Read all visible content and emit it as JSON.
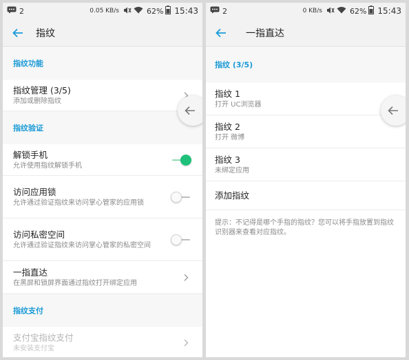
{
  "status_left": {
    "notification_count": "2",
    "net_speed": "0.05 KB/s",
    "battery": "62%",
    "time": "15:43"
  },
  "status_right": {
    "notification_count": "2",
    "net_speed": "0 KB/s",
    "battery": "62%",
    "time": "15:43"
  },
  "left": {
    "title": "指纹",
    "sections": {
      "function_header": "指纹功能",
      "verify_header": "指纹验证",
      "pay_header": "指纹支付"
    },
    "items": {
      "manage": {
        "title": "指纹管理 (3/5)",
        "sub": "添加或删除指纹"
      },
      "unlock": {
        "title": "解锁手机",
        "sub": "允许使用指纹解锁手机",
        "enabled": true
      },
      "app_lock": {
        "title": "访问应用锁",
        "sub": "允许通过验证指纹来访问掌心管家的应用锁",
        "enabled": false
      },
      "private_space": {
        "title": "访问私密空间",
        "sub": "允许通过验证指纹来访问掌心管家的私密空间",
        "enabled": false
      },
      "quick_launch": {
        "title": "一指直达",
        "sub": "在黑屏和锁屏界面通过指纹打开绑定应用"
      },
      "alipay": {
        "title": "支付宝指纹支付",
        "sub": "未安装支付宝"
      }
    }
  },
  "right": {
    "title": "一指直达",
    "section_header": "指纹 (3/5)",
    "fingerprints": [
      {
        "title": "指纹 1",
        "sub": "打开 UC浏览器"
      },
      {
        "title": "指纹 2",
        "sub": "打开 微博"
      },
      {
        "title": "指纹 3",
        "sub": "未绑定应用"
      }
    ],
    "add_label": "添加指纹",
    "hint": "提示：不记得是哪个手指的指纹？您可以将手指放置到指纹识别器来查看对应指纹。"
  },
  "colors": {
    "accent": "#1a9ad6",
    "switch_on": "#1ec07a",
    "background": "#d9d9d9"
  },
  "icons": {
    "back": "arrow-left-icon",
    "chevron": "chevron-right-icon",
    "floating_back": "floating-back-icon"
  }
}
